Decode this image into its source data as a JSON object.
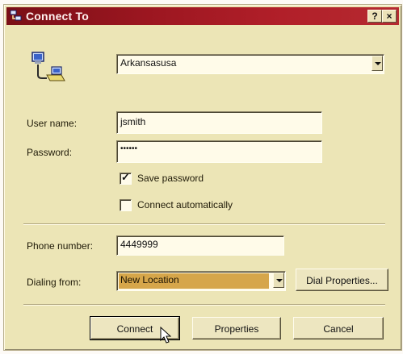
{
  "window": {
    "title": "Connect To",
    "help_label": "?",
    "close_label": "×"
  },
  "connection": {
    "entry": "Arkansasusa"
  },
  "fields": {
    "user_label": "User name:",
    "user_value": "jsmith",
    "password_label": "Password:",
    "password_value": "••••••",
    "save_password_label": "Save password",
    "save_password_checked": true,
    "connect_auto_label": "Connect automatically",
    "connect_auto_checked": false
  },
  "dialing": {
    "phone_label": "Phone number:",
    "phone_value": "4449999",
    "from_label": "Dialing from:",
    "from_value": "New Location"
  },
  "buttons": {
    "dial_properties": "Dial Properties...",
    "connect": "Connect",
    "properties": "Properties",
    "cancel": "Cancel"
  },
  "colors": {
    "title_bar": "#9b1620",
    "dialog_face": "#ece5b6",
    "selected_highlight": "#d6a64a"
  },
  "icons": [
    "network-computers-icon",
    "mouse-cursor-icon"
  ]
}
